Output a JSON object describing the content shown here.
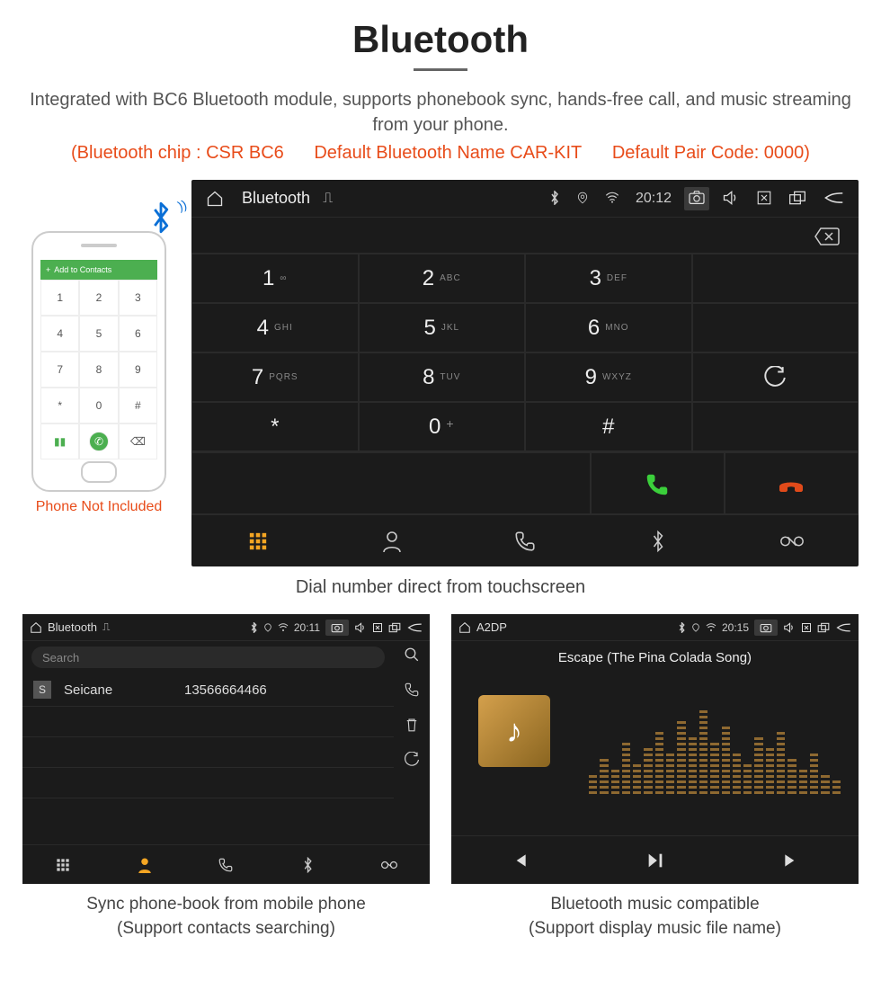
{
  "header": {
    "title": "Bluetooth",
    "description": "Integrated with BC6 Bluetooth module, supports phonebook sync, hands-free call, and music streaming from your phone.",
    "spec_chip": "(Bluetooth chip : CSR BC6",
    "spec_name": "Default Bluetooth Name CAR-KIT",
    "spec_code": "Default Pair Code: 0000)"
  },
  "phone": {
    "bar_label": "Add to Contacts",
    "note": "Phone Not Included"
  },
  "dialer": {
    "status": {
      "app": "Bluetooth",
      "time": "20:12"
    },
    "keys": [
      {
        "n": "1",
        "s": "∞"
      },
      {
        "n": "2",
        "s": "ABC"
      },
      {
        "n": "3",
        "s": "DEF"
      },
      {
        "n": "4",
        "s": "GHI"
      },
      {
        "n": "5",
        "s": "JKL"
      },
      {
        "n": "6",
        "s": "MNO"
      },
      {
        "n": "7",
        "s": "PQRS"
      },
      {
        "n": "8",
        "s": "TUV"
      },
      {
        "n": "9",
        "s": "WXYZ"
      },
      {
        "n": "*",
        "s": ""
      },
      {
        "n": "0",
        "s": "+"
      },
      {
        "n": "#",
        "s": ""
      }
    ],
    "caption": "Dial number direct from touchscreen"
  },
  "phonebook": {
    "status": {
      "app": "Bluetooth",
      "time": "20:11"
    },
    "search_placeholder": "Search",
    "contacts": [
      {
        "badge": "S",
        "name": "Seicane",
        "number": "13566664466"
      }
    ],
    "caption_line1": "Sync phone-book from mobile phone",
    "caption_line2": "(Support contacts searching)"
  },
  "a2dp": {
    "status": {
      "app": "A2DP",
      "time": "20:15"
    },
    "song": "Escape (The Pina Colada Song)",
    "caption_line1": "Bluetooth music compatible",
    "caption_line2": "(Support display music file name)"
  }
}
